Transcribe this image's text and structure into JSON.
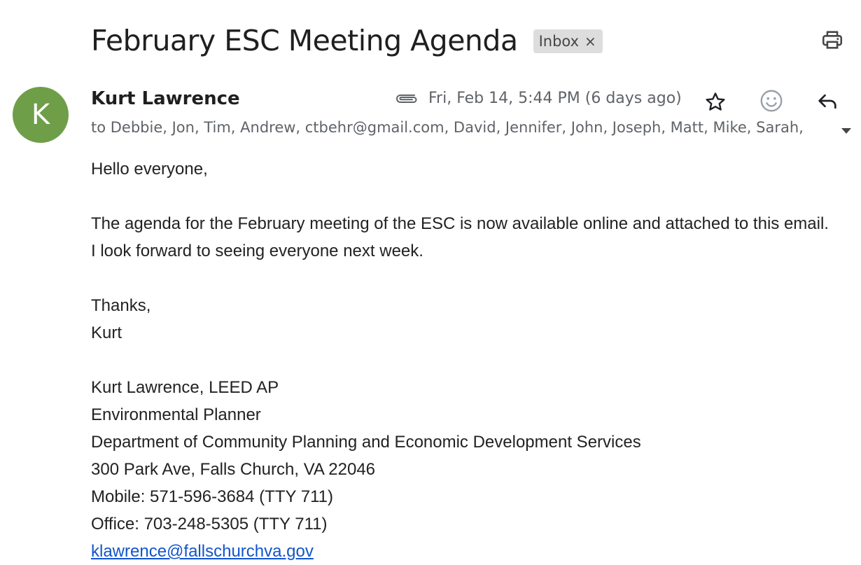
{
  "email": {
    "subject": "February ESC Meeting Agenda",
    "label": "Inbox",
    "label_close": "×",
    "sender": {
      "name": "Kurt Lawrence",
      "initial": "K",
      "avatar_color": "#6f9e49"
    },
    "date": "Fri, Feb 14, 5:44 PM (6 days ago)",
    "recipients": "to Debbie, Jon, Tim, Andrew, ctbehr@gmail.com, David, Jennifer, John, Joseph, Matt, Mike, Sarah,",
    "body": {
      "greeting": "Hello everyone,",
      "paragraph_line1": "The agenda for the February meeting of the ESC is now available online and attached to this email.",
      "paragraph_line2": "I look forward to seeing everyone next week.",
      "closing": "Thanks,",
      "sign_name": "Kurt"
    },
    "signature": {
      "name_title": "Kurt Lawrence, LEED AP",
      "role": "Environmental Planner",
      "department": "Department of Community Planning and Economic Development Services",
      "address": "300 Park Ave, Falls Church, VA 22046",
      "mobile": "Mobile: 571-596-3684 (TTY 711)",
      "office": "Office: 703-248-5305 (TTY 711)",
      "email": "klawrence@fallschurchva.gov"
    }
  },
  "icons": {
    "print": "print-icon",
    "attachment": "paperclip-icon",
    "star": "star-icon",
    "emoji": "smiley-icon",
    "reply": "reply-icon",
    "expand": "caret-down-icon"
  },
  "colors": {
    "avatar": "#6f9e49",
    "chip_bg": "#dddddd",
    "meta_text": "#5f6368",
    "link": "#1155cc"
  }
}
